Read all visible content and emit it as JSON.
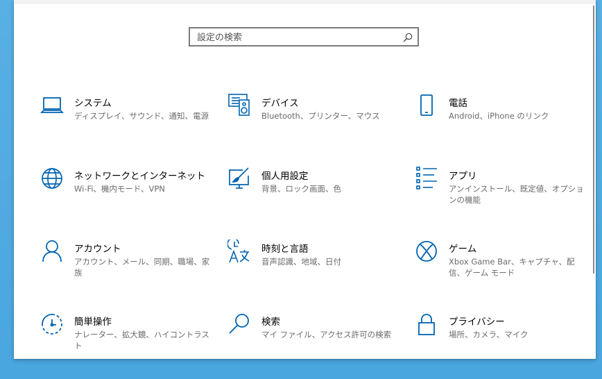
{
  "search": {
    "placeholder": "設定の検索"
  },
  "tiles": [
    {
      "title": "システム",
      "desc": "ディスプレイ、サウンド、通知、電源",
      "icon": "laptop-icon"
    },
    {
      "title": "デバイス",
      "desc": "Bluetooth、プリンター、マウス",
      "icon": "devices-icon"
    },
    {
      "title": "電話",
      "desc": "Android、iPhone のリンク",
      "icon": "phone-icon"
    },
    {
      "title": "ネットワークとインターネット",
      "desc": "Wi-Fi、機内モード、VPN",
      "icon": "globe-icon"
    },
    {
      "title": "個人用設定",
      "desc": "背景、ロック画面、色",
      "icon": "personalization-icon"
    },
    {
      "title": "アプリ",
      "desc": "アンインストール、既定値、オプションの機能",
      "icon": "apps-list-icon"
    },
    {
      "title": "アカウント",
      "desc": "アカウント、メール、同期、職場、家族",
      "icon": "person-icon"
    },
    {
      "title": "時刻と言語",
      "desc": "音声認識、地域、日付",
      "icon": "time-language-icon"
    },
    {
      "title": "ゲーム",
      "desc": "Xbox Game Bar、キャプチャ、配信、ゲーム モード",
      "icon": "xbox-icon"
    },
    {
      "title": "簡単操作",
      "desc": "ナレーター、拡大鏡、ハイコントラスト",
      "icon": "ease-of-access-icon"
    },
    {
      "title": "検索",
      "desc": "マイ ファイル、アクセス許可の検索",
      "icon": "search-icon"
    },
    {
      "title": "プライバシー",
      "desc": "場所、カメラ、マイク",
      "icon": "lock-icon"
    }
  ],
  "colors": {
    "accent": "#0063b1",
    "background": "#4aa6df"
  }
}
